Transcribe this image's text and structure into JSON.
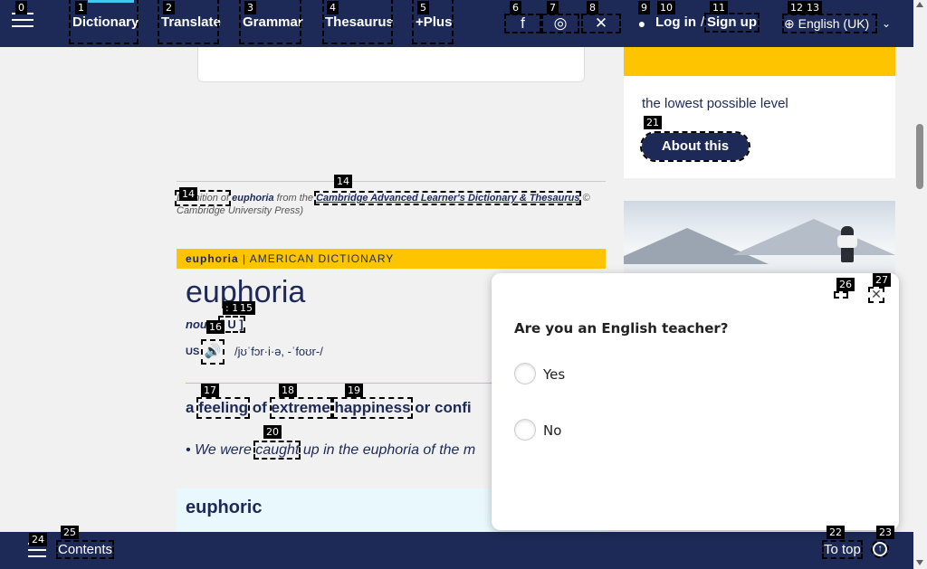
{
  "nav": {
    "items": [
      "Dictionary",
      "Translate",
      "Grammar",
      "Thesaurus",
      "+Plus"
    ],
    "login": "Log in",
    "slash": "/",
    "signup": "Sign up",
    "language": "English (UK)"
  },
  "attribution": {
    "prefix": "Definition of",
    "word": "euphoria",
    "from": "from the",
    "source": "Cambridge Advanced Learner's Dictionary & Thesaurus",
    "copyright": "© Cambridge University Press)"
  },
  "entry": {
    "section_word": "euphoria",
    "section_label": "| AMERICAN DICTIONARY",
    "headword": "euphoria",
    "pos": "noun",
    "pos_code": "[ U ]",
    "us_label": "US",
    "pronunciation": "/jʊˈfɔr·i·ə, -ˈfoʊr-/",
    "definition": {
      "a": "a",
      "w1": "feeling",
      "of": "of",
      "w2": "extreme",
      "w3": "happiness",
      "rest": "or confi"
    },
    "example": {
      "bullet": "•",
      "before": "We were",
      "link": "caught",
      "after": "up in the euphoria of the m"
    },
    "runon_word": "euphoric"
  },
  "sidebar": {
    "wotd_text": "the lowest possible level",
    "about_button": "About this"
  },
  "popup": {
    "question": "Are you an English teacher?",
    "options": [
      "Yes",
      "No"
    ]
  },
  "bottombar": {
    "contents": "Contents",
    "to_top": "To top"
  },
  "markers": {
    "m0": "0",
    "m1": "1",
    "m2": "2",
    "m3": "3",
    "m4": "4",
    "m5": "5",
    "m6": "6",
    "m7": "7",
    "m8": "8",
    "m9": "9",
    "m10": "10",
    "m11": "11",
    "m12": "12",
    "m13": "13",
    "m14a": "14",
    "m14b": "14",
    "m15": "15",
    "m15pre": ": 1",
    "m16": "16",
    "m17": "17",
    "m18": "18",
    "m19": "19",
    "m20": "20",
    "m21": "21",
    "m22": "22",
    "m23": "23",
    "m24": "24",
    "m25": "25",
    "m26": "26",
    "m27": "27"
  },
  "colors": {
    "brand_navy": "#1d2a57",
    "accent_yellow": "#fec400",
    "accent_cyan": "#3ec8f4",
    "runon_bg": "#e8f8fd"
  }
}
